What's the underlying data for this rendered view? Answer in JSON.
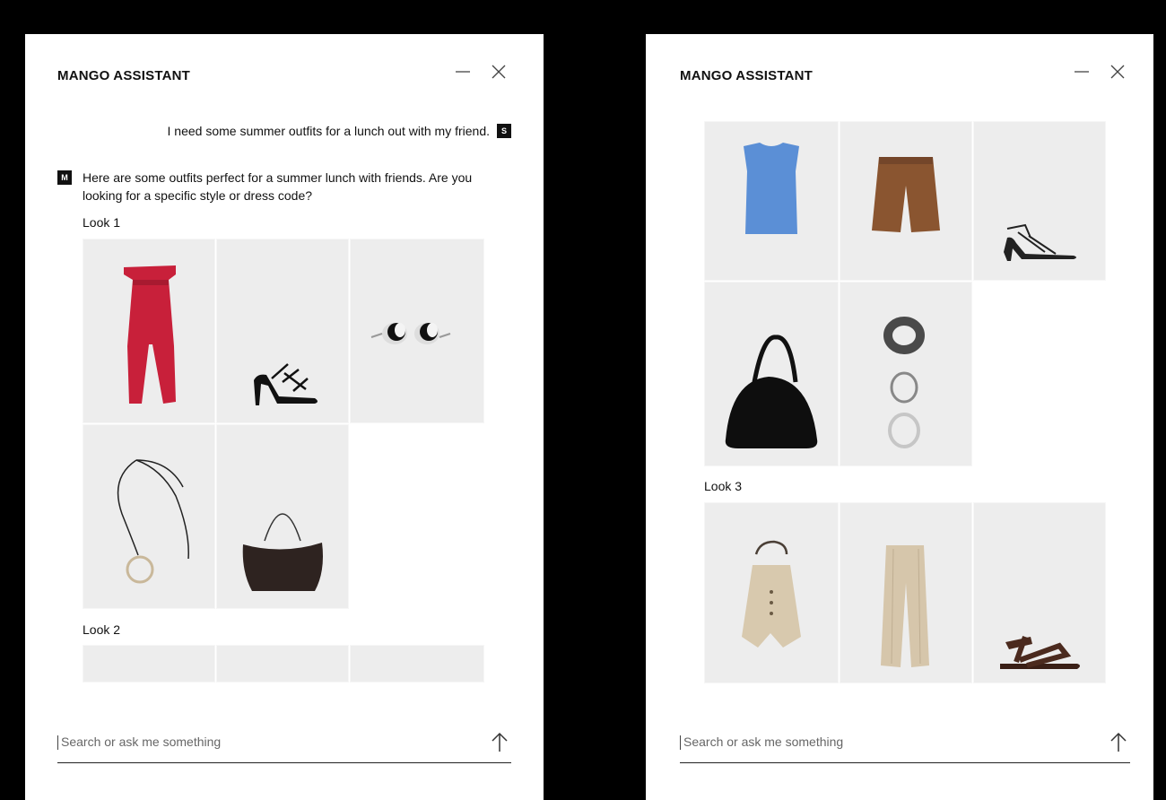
{
  "panels": [
    {
      "header": {
        "title": "MANGO ASSISTANT"
      },
      "user_message": {
        "text": "I need some summer outfits for a lunch out with my friend.",
        "avatar": "S"
      },
      "assistant_message": {
        "avatar": "M",
        "text": "Here are some outfits perfect for a summer lunch with friends. Are you looking for a specific style or dress code?"
      },
      "look1": {
        "label": "Look 1",
        "items": [
          "red-strapless-jumpsuit",
          "black-strappy-heeled-sandals",
          "silver-black-earrings",
          "cord-pendant-necklace",
          "brown-shoulder-bag"
        ]
      },
      "look2": {
        "label": "Look 2"
      },
      "search": {
        "placeholder": "Search or ask me something",
        "send_icon": "arrow-up-icon"
      }
    },
    {
      "header": {
        "title": "MANGO ASSISTANT"
      },
      "look2_items": [
        "blue-sleeveless-top",
        "brown-bermuda-shorts",
        "black-strappy-sandals",
        "black-hobo-bag",
        "bracelet-set"
      ],
      "look3": {
        "label": "Look 3",
        "items": [
          "beige-halter-waistcoat",
          "beige-pleated-trousers",
          "brown-flat-sandals"
        ]
      },
      "search": {
        "placeholder": "Search or ask me something",
        "send_icon": "arrow-up-icon"
      }
    }
  ],
  "icons": {
    "minimize": "minimize-icon",
    "close": "close-icon"
  },
  "colors": {
    "background": "#000000",
    "panel": "#ffffff",
    "tile": "#ededed",
    "accent": "#111111"
  }
}
